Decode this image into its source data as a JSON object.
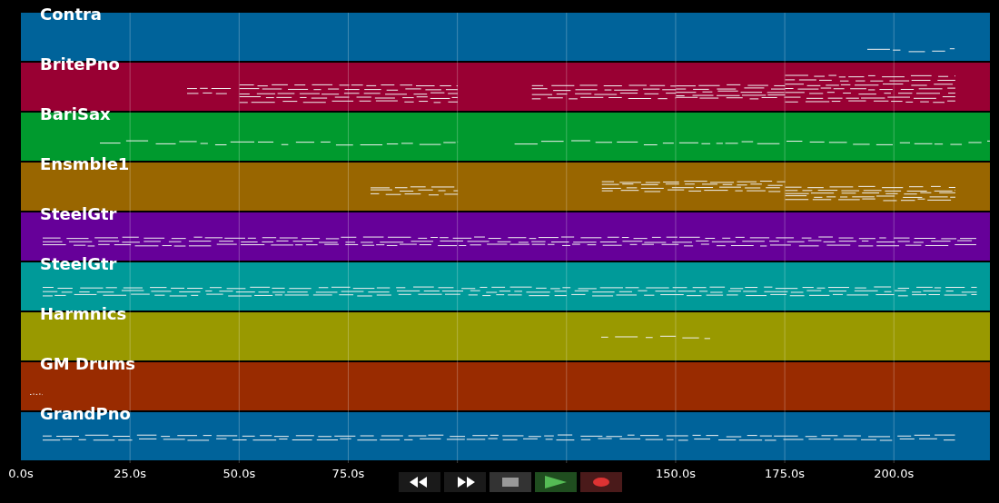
{
  "tracks": [
    {
      "name": "Contra",
      "color": "#00639a"
    },
    {
      "name": "BritePno",
      "color": "#990033"
    },
    {
      "name": "BariSax",
      "color": "#009a2e"
    },
    {
      "name": "Ensmble1",
      "color": "#996600"
    },
    {
      "name": "SteelGtr",
      "color": "#660099"
    },
    {
      "name": "SteelGtr",
      "color": "#009a99"
    },
    {
      "name": "Harmnics",
      "color": "#999900"
    },
    {
      "name": "GM Drums",
      "color": "#992b00"
    },
    {
      "name": "GrandPno",
      "color": "#00639a"
    }
  ],
  "time_axis": {
    "labels_before_controls": [
      "0.0s",
      "25.0s",
      "50.0s",
      "75.0s"
    ],
    "labels_after_controls": [
      "150.0s",
      "175.0s",
      "200.0s"
    ]
  },
  "transport_buttons": [
    {
      "kind": "rewind"
    },
    {
      "kind": "forward"
    },
    {
      "kind": "stop"
    },
    {
      "kind": "play"
    },
    {
      "kind": "record"
    }
  ]
}
